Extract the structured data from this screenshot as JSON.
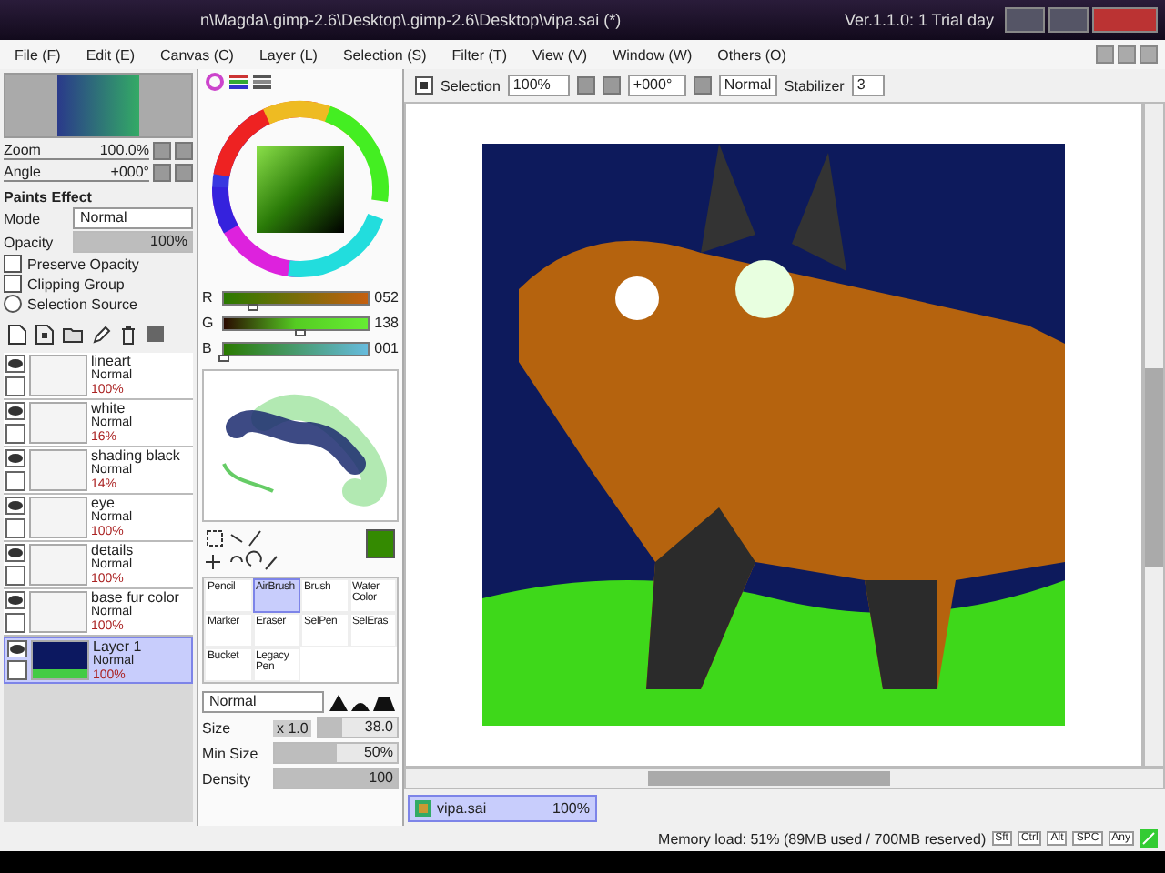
{
  "window": {
    "title": "n\\Magda\\.gimp-2.6\\Desktop\\.gimp-2.6\\Desktop\\vipa.sai (*)",
    "version": "Ver.1.1.0: 1 Trial day"
  },
  "menu": [
    "File (F)",
    "Edit (E)",
    "Canvas (C)",
    "Layer (L)",
    "Selection (S)",
    "Filter (T)",
    "View (V)",
    "Window (W)",
    "Others (O)"
  ],
  "navigator": {
    "zoom_label": "Zoom",
    "zoom": "100.0%",
    "angle_label": "Angle",
    "angle": "+000°"
  },
  "paint_effect": {
    "title": "Paints Effect",
    "mode_label": "Mode",
    "mode": "Normal",
    "opacity_label": "Opacity",
    "opacity": "100%",
    "level": 1,
    "options": [
      {
        "kind": "checkbox",
        "label": "Preserve Opacity",
        "checked": false
      },
      {
        "kind": "checkbox",
        "label": "Clipping Group",
        "checked": false
      },
      {
        "kind": "radio",
        "label": "Selection Source",
        "checked": false
      }
    ]
  },
  "layers": [
    {
      "name": "lineart",
      "mode": "Normal",
      "opacity": "100%",
      "visible": true,
      "selected": false
    },
    {
      "name": "white",
      "mode": "Normal",
      "opacity": "16%",
      "visible": true,
      "selected": false
    },
    {
      "name": "shading black",
      "mode": "Normal",
      "opacity": "14%",
      "visible": true,
      "selected": false
    },
    {
      "name": "eye",
      "mode": "Normal",
      "opacity": "100%",
      "visible": true,
      "selected": false
    },
    {
      "name": "details",
      "mode": "Normal",
      "opacity": "100%",
      "visible": true,
      "selected": false
    },
    {
      "name": "base fur color",
      "mode": "Normal",
      "opacity": "100%",
      "visible": true,
      "selected": false
    },
    {
      "name": "Layer 1",
      "mode": "Normal",
      "opacity": "100%",
      "visible": true,
      "selected": true
    }
  ],
  "color": {
    "sliders": [
      {
        "label": "R",
        "value": "052",
        "level": 0.2
      },
      {
        "label": "G",
        "value": "138",
        "level": 0.54
      },
      {
        "label": "B",
        "value": "001",
        "level": 0.0
      }
    ]
  },
  "tools": [
    {
      "label": "Pencil",
      "selected": false
    },
    {
      "label": "AirBrush",
      "selected": true
    },
    {
      "label": "Brush",
      "selected": false
    },
    {
      "label": "Water Color",
      "selected": false
    },
    {
      "label": "Marker",
      "selected": false
    },
    {
      "label": "Eraser",
      "selected": false
    },
    {
      "label": "SelPen",
      "selected": false
    },
    {
      "label": "SelEras",
      "selected": false
    },
    {
      "label": "Bucket",
      "selected": false
    },
    {
      "label": "Legacy Pen",
      "selected": false
    }
  ],
  "brush": {
    "mode": "Normal",
    "size": {
      "label": "Size",
      "scale": "x 1.0",
      "value": "38.0",
      "level": 0.3
    },
    "sliders": [
      {
        "label": "Min Size",
        "value": "50%",
        "level": 0.5
      },
      {
        "label": "Density",
        "value": "100",
        "level": 1
      }
    ]
  },
  "toolbar": {
    "selection_label": "Selection",
    "selection_checked": true,
    "zoom": "100%",
    "angle": "+000°",
    "blend": "Normal",
    "stabilizer_label": "Stabilizer",
    "stabilizer": "3"
  },
  "document_tab": {
    "name": "vipa.sai",
    "zoom": "100%"
  },
  "status_bar": {
    "memory": "Memory load: 51% (89MB used / 700MB reserved)",
    "keys": [
      "Sft",
      "Ctrl",
      "Alt",
      "SPC",
      "Any"
    ]
  }
}
